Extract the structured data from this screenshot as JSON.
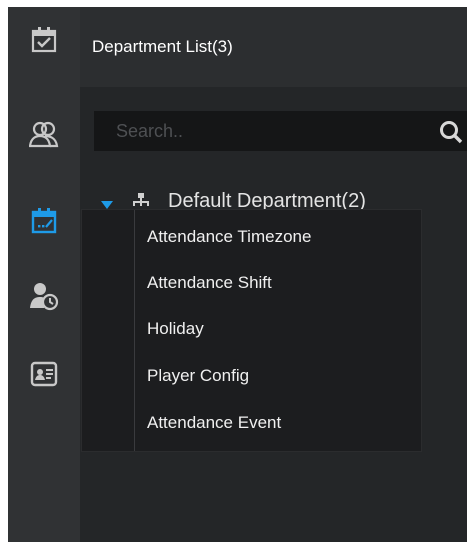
{
  "rail": {
    "items": [
      {
        "name": "attendance-check",
        "icon": "calendar-check-icon",
        "active": false
      },
      {
        "name": "users",
        "icon": "users-icon",
        "active": false
      },
      {
        "name": "attendance-config",
        "icon": "calendar-edit-icon",
        "active": true
      },
      {
        "name": "user-schedule",
        "icon": "user-clock-icon",
        "active": false
      },
      {
        "name": "report",
        "icon": "id-card-icon",
        "active": false
      }
    ],
    "colors": {
      "active": "#1e9be8",
      "inactive": "#c8c8c8"
    }
  },
  "panel": {
    "title": "Department List(3)",
    "search_placeholder": "Search.."
  },
  "tree": {
    "root_label": "Default Department(2)",
    "expanded": true,
    "arrow_color": "#1e9be8"
  },
  "menu": {
    "items": [
      "Attendance Timezone",
      "Attendance Shift",
      "Holiday",
      "Player Config",
      "Attendance Event"
    ]
  }
}
